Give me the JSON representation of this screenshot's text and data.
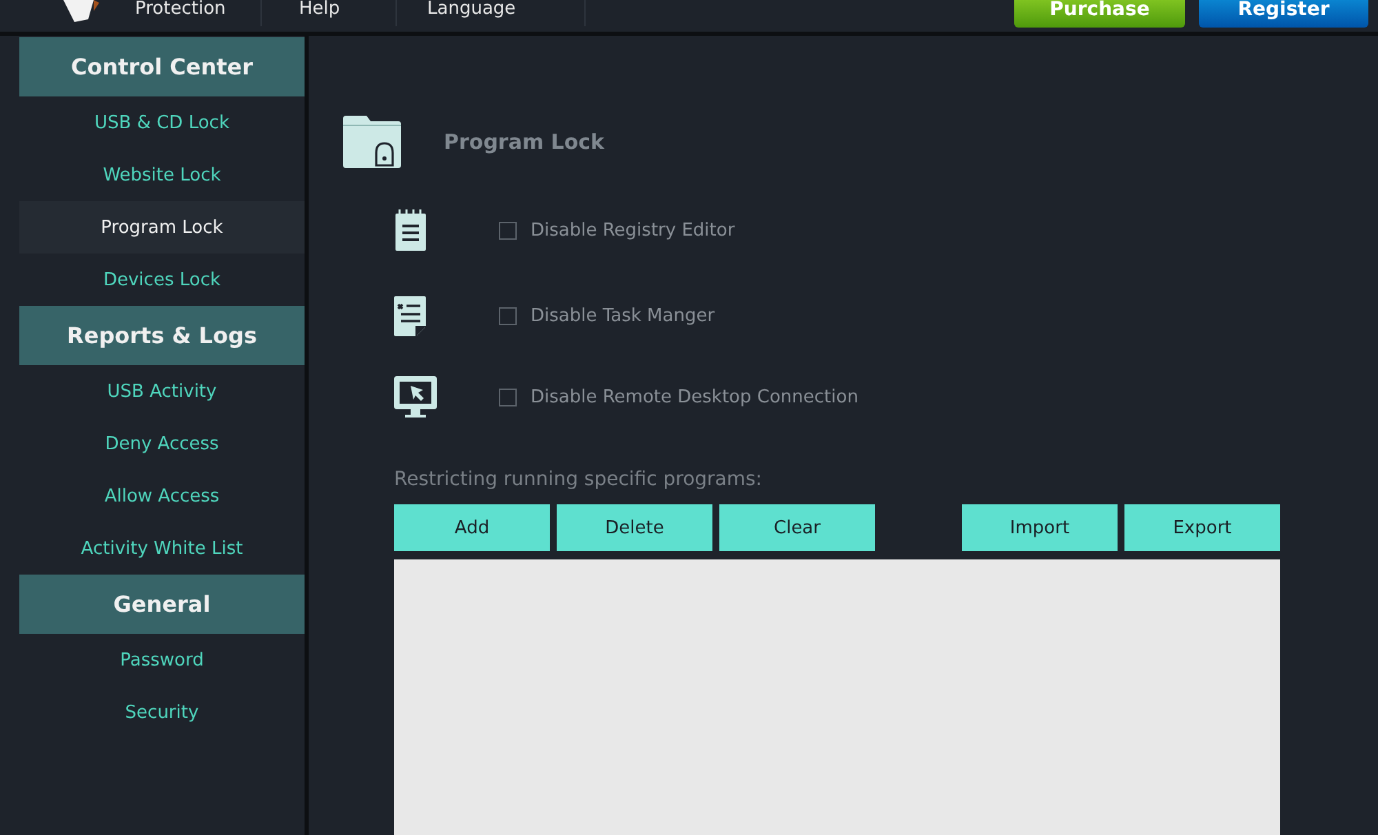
{
  "menu": [
    {
      "label": "Protection"
    },
    {
      "label": "Help"
    },
    {
      "label": "Language"
    }
  ],
  "top_buttons": [
    {
      "label": "Purchase",
      "kind": "purchase"
    },
    {
      "label": "Register",
      "kind": "register"
    }
  ],
  "sidebar": [
    {
      "title": "Control Center",
      "items": [
        {
          "label": "USB & CD Lock",
          "selected": false
        },
        {
          "label": "Website Lock",
          "selected": false
        },
        {
          "label": "Program Lock",
          "selected": true
        },
        {
          "label": "Devices Lock",
          "selected": false
        }
      ]
    },
    {
      "title": "Reports & Logs",
      "items": [
        {
          "label": "USB Activity",
          "selected": false
        },
        {
          "label": "Deny Access",
          "selected": false
        },
        {
          "label": "Allow Access",
          "selected": false
        },
        {
          "label": "Activity White List",
          "selected": false
        }
      ]
    },
    {
      "title": "General",
      "items": [
        {
          "label": "Password",
          "selected": false
        },
        {
          "label": "Security",
          "selected": false
        }
      ]
    }
  ],
  "page_title": "Program Lock",
  "options": [
    {
      "label": "Disable Registry Editor",
      "checked": false,
      "kind": "registry"
    },
    {
      "label": "Disable Task Manger",
      "checked": false,
      "kind": "task"
    },
    {
      "label": "Disable Remote Desktop Connection",
      "checked": false,
      "kind": "remote"
    }
  ],
  "restrict_label": "Restricting running specific programs:",
  "list_buttons": [
    [
      {
        "label": "Add"
      },
      {
        "label": "Delete"
      },
      {
        "label": "Clear"
      }
    ],
    [
      {
        "label": "Import"
      },
      {
        "label": "Export"
      }
    ]
  ]
}
